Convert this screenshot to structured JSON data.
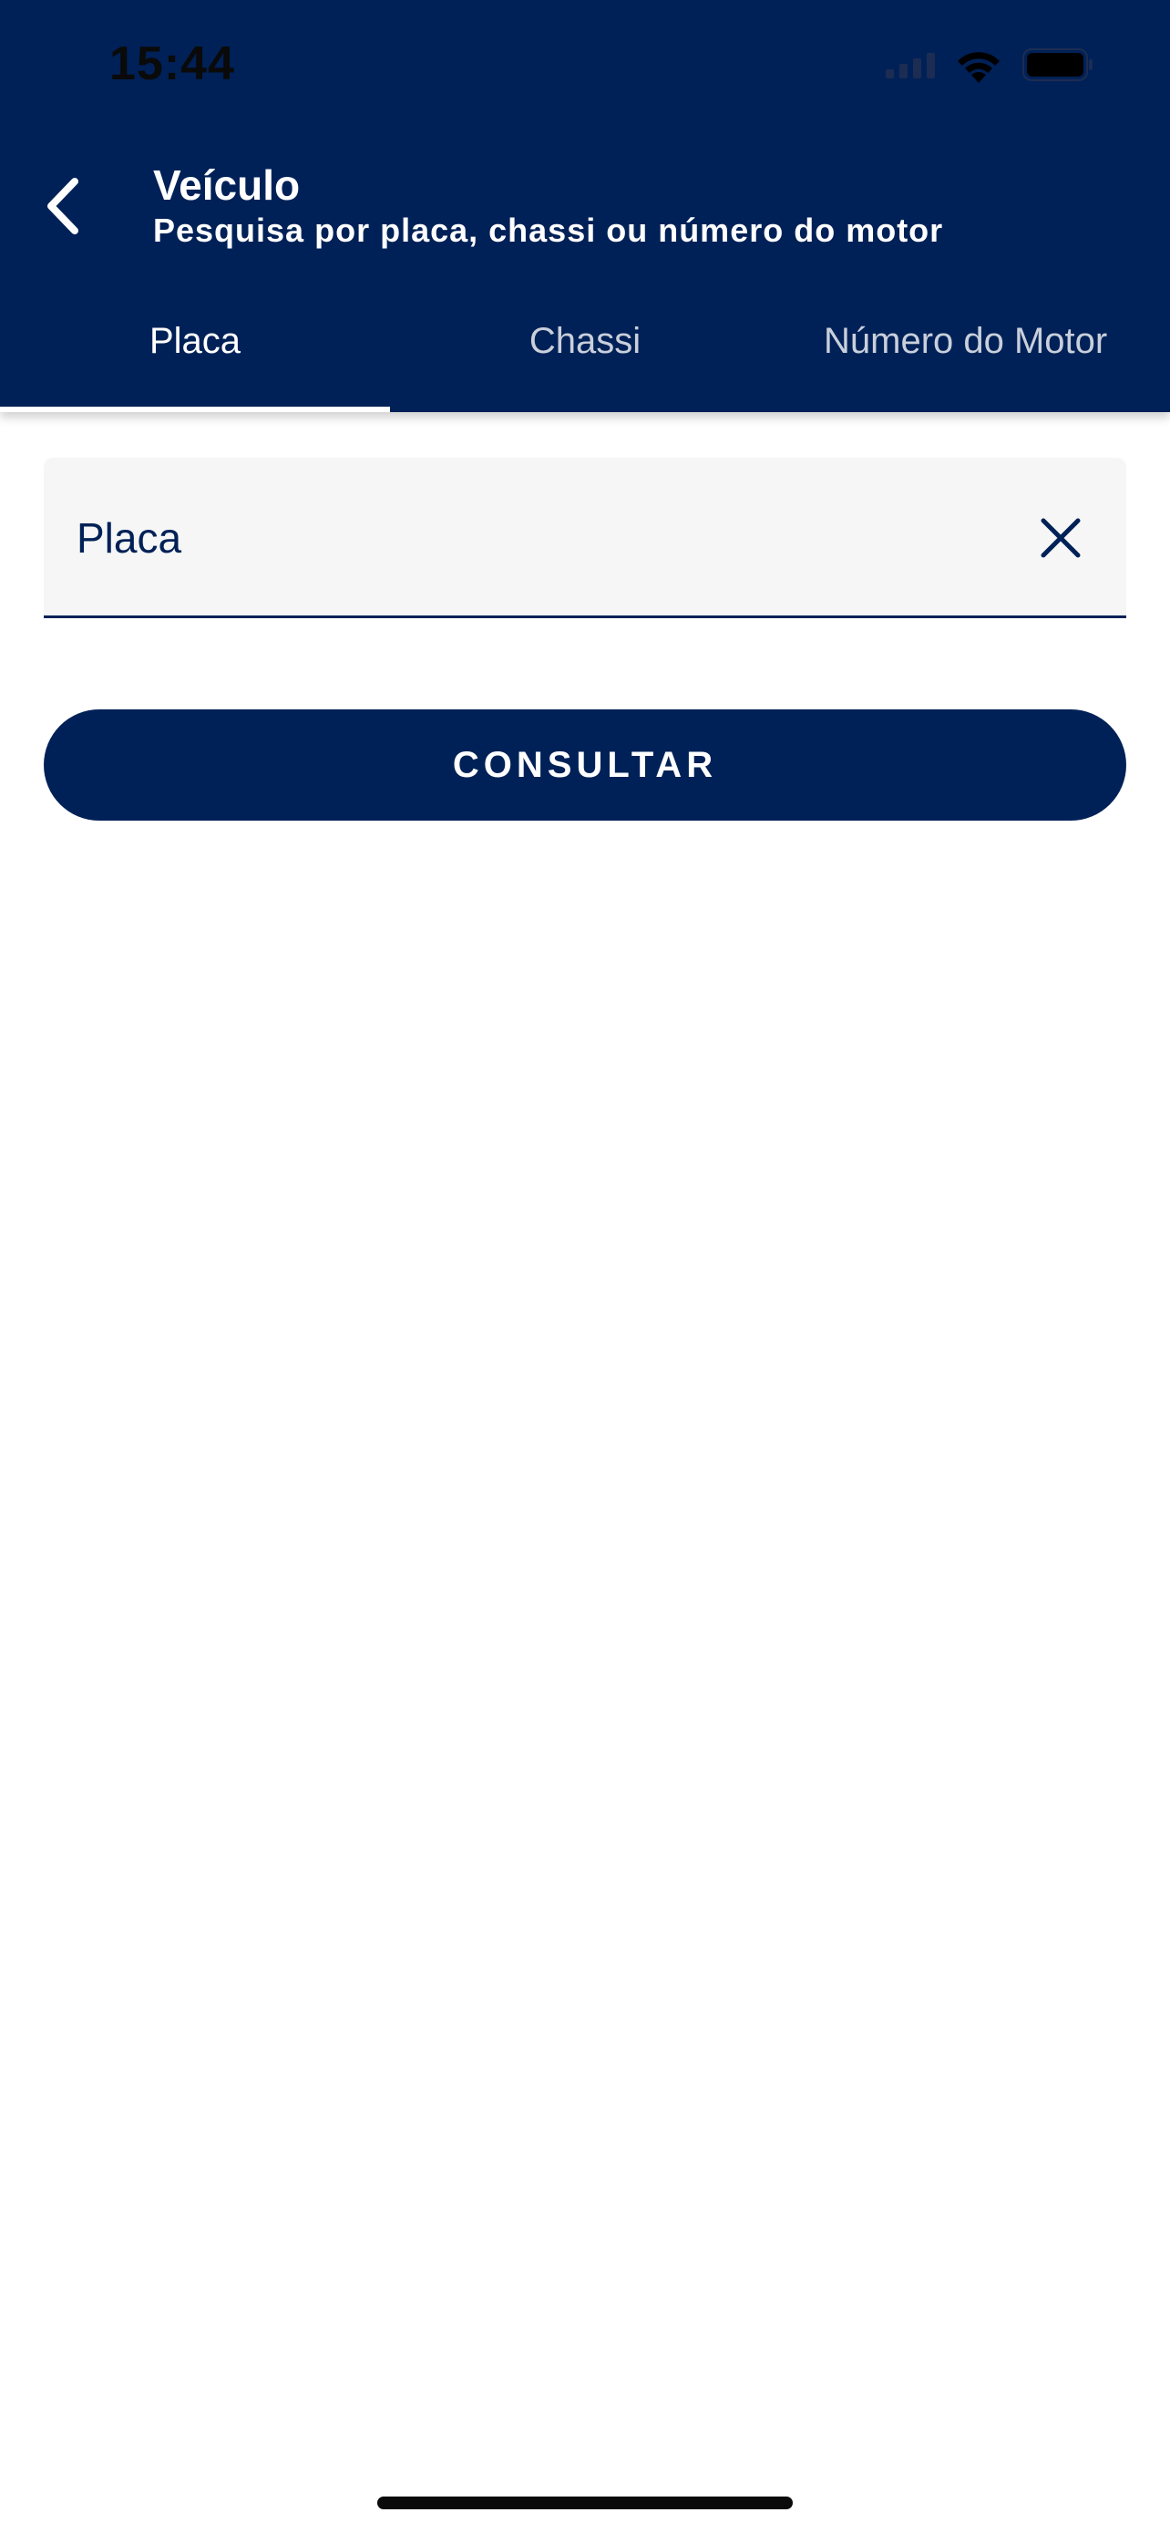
{
  "status_bar": {
    "time": "15:44"
  },
  "header": {
    "title": "Veículo",
    "subtitle": "Pesquisa por placa, chassi ou número do motor"
  },
  "tabs": [
    {
      "label": "Placa",
      "active": true
    },
    {
      "label": "Chassi",
      "active": false
    },
    {
      "label": "Número do Motor",
      "active": false
    }
  ],
  "search": {
    "value": "",
    "placeholder": "Placa"
  },
  "actions": {
    "consult_label": "CONSULTAR"
  },
  "icons": {
    "back": "chevron-left-icon",
    "clear": "close-icon",
    "signal": "cellular-signal-icon",
    "wifi": "wifi-icon",
    "battery": "battery-icon"
  },
  "colors": {
    "primary": "#002157",
    "field_background": "#f6f6f6",
    "on_primary": "#ffffff"
  }
}
